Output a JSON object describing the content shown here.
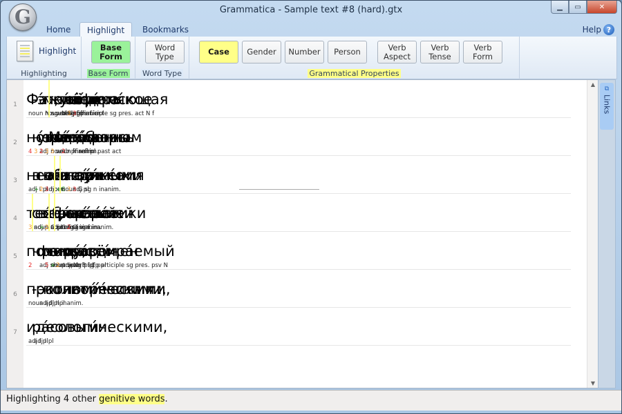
{
  "window": {
    "title": "Grammatica - Sample text #8 (hard).gtx",
    "orb_letter": "G",
    "controls": {
      "minimize": "▁",
      "maximize": "▭",
      "close": "✕"
    }
  },
  "tabs": [
    {
      "label": "Home",
      "active": false
    },
    {
      "label": "Highlight",
      "active": true
    },
    {
      "label": "Bookmarks",
      "active": false
    }
  ],
  "help": {
    "label": "Help",
    "icon": "?"
  },
  "ribbon": {
    "groups": [
      {
        "label": "Highlighting",
        "buttons": [
          "Highlight"
        ]
      },
      {
        "label": "Base Form",
        "label_color": "#9af29a",
        "buttons": [
          "Base Form"
        ]
      },
      {
        "label": "Word Type",
        "label_color": "#dce9f8",
        "buttons": [
          "Word Type"
        ]
      },
      {
        "label": "Grammatical Properties",
        "label_color": "#ffff88",
        "buttons": [
          "Case",
          "Gender",
          "Number",
          "Person",
          "Verb Aspect",
          "Verb Tense",
          "Verb Form"
        ]
      }
    ],
    "highlight_label": "Highlight",
    "base_form": [
      "Base",
      "Form"
    ],
    "word_type": [
      "Word",
      "Type"
    ],
    "case": "Case",
    "gender": "Gender",
    "number": "Number",
    "person": "Person",
    "verb_aspect": [
      "Verb",
      "Aspect"
    ],
    "verb_tense": [
      "Verb",
      "Tense"
    ],
    "verb_form": [
      "Verb",
      "Form"
    ],
    "active_colors": {
      "base_form": "#9af29a",
      "case": "#ffff88"
    }
  },
  "lines": [
    {
      "number": "1",
      "words": [
        {
          "text": "Фантасти́ческое",
          "ann": [
            {
              "t": "noun N sg n inanim."
            }
          ]
        },
        {
          "text": "-"
        },
        {
          "text": "э́то"
        },
        {
          "text": "мета́фора",
          "ann": [
            {
              "t": "noun N sg f inanim."
            }
          ]
        },
        {
          "text": "жи́зни",
          "hl": true,
          "ann": [
            {
              "t": "noun G sg f"
            }
          ]
        },
        {
          "text": ", позволя́ющая",
          "ann": [
            {
              "t": "verb ipf participle sg pres. act N f"
            }
          ]
        },
        {
          "text": "уви́деть",
          "ann": [
            {
              "t": "verb pf inf. act"
            }
          ]
        },
        {
          "text": "её",
          "ann": [
            {
              "n": "3",
              "c": "or"
            },
            {
              "t": "prn"
            }
          ]
        },
        {
          "text": "под",
          "ann": [
            {
              "n": "3",
              "c": "rd"
            }
          ]
        }
      ]
    },
    {
      "number": "2",
      "words": [
        {
          "text": "но́вым,",
          "ann": [
            {
              "n": "4",
              "c": "rd"
            }
          ]
        },
        {
          "text": "неожи́данным",
          "ann": [
            {
              "n": "3",
              "c": "or"
            },
            {
              "t": "adj"
            }
          ]
        },
        {
          "text": "угло́м",
          "ann": [
            {
              "n": "2",
              "c": "rd"
            }
          ]
        },
        {
          "text": "зре́ния.",
          "ann": [
            {
              "n": "3",
              "c": "or"
            },
            {
              "t": "noun n inanim."
            }
          ]
        },
        {
          "text": "Мета́форы",
          "ann": [
            {
              "n": "3",
              "c": "or"
            },
            {
              "t": "noun f inanim."
            }
          ]
        },
        {
          "text": "сде́лались",
          "ann": [
            {
              "t": "verb pf refl pl past act"
            }
          ]
        },
        {
          "text": "осо́бенно",
          "ann": [
            {
              "n": "2",
              "c": "rd"
            }
          ]
        }
      ]
    },
    {
      "number": "3",
      "words": [
        {
          "text": "необходи́мыми",
          "ann": [
            {
              "t": "adj I pl"
            }
          ]
        },
        {
          "text": "в",
          "ann": [
            {
              "n": "+",
              "c": "gr"
            }
          ]
        },
        {
          "text": "наш",
          "ann": [
            {
              "n": "2",
              "c": "or"
            },
            {
              "t": "adjprn"
            }
          ]
        },
        {
          "text": "век",
          "ann": [
            {
              "n": "3",
              "c": "rd"
            },
            {
              "t": "noun"
            }
          ]
        },
        {
          "text": "не то́лько"
        },
        {
          "text": "и́з-за",
          "hl": true,
          "inner_white": true,
          "ann": [
            {
              "n": "+G",
              "c": "gr"
            }
          ]
        },
        {
          "text": "вторже́ния",
          "hl": true,
          "ann": [
            {
              "t": "noun G sg n inanim."
            }
          ]
        },
        {
          "text": "нау́чных",
          "ann": [
            {
              "n": "3",
              "c": "or"
            },
            {
              "t": "adj pl"
            }
          ]
        },
        {
          "text": "и",
          "ann": [
            {
              "n": "3",
              "c": "rd"
            }
          ]
        }
      ]
    },
    {
      "number": "4",
      "words": [
        {
          "text": "техни́ческих",
          "ann": [
            {
              "n": "3",
              "c": "or"
            },
            {
              "t": "adj pl"
            }
          ]
        },
        {
          "text": "сверше́ний",
          "hl": true,
          "ann": [
            {
              "t": "noun G pl n inanim."
            }
          ]
        },
        {
          "text": "в",
          "ann": [
            {
              "n": "+",
              "c": "gr"
            }
          ]
        },
        {
          "text": "о́бласть",
          "ann": [
            {
              "n": "2",
              "c": "or"
            },
            {
              "t": "noun sg f inanim."
            }
          ]
        },
        {
          "text": "вчера́шней",
          "hl": true,
          "ann": [
            {
              "t": "adj G f sg"
            }
          ]
        },
        {
          "text": "фанта́стики",
          "hl": true,
          "ann": [
            {
              "t": "noun G sg f inanim."
            }
          ]
        },
        {
          "text": ", но"
        },
        {
          "text": "скоре́е",
          "ann": [
            {
              "n": "2",
              "c": "rd"
            }
          ]
        }
      ]
    },
    {
      "number": "5",
      "words": [
        {
          "text": "потому́,",
          "ann": [
            {
              "n": "2",
              "c": "rd"
            }
          ]
        },
        {
          "text": "что"
        },
        {
          "text": "фантасти́чен",
          "ann": [
            {
              "t": "adj short m sg"
            }
          ]
        },
        {
          "text": "мир,",
          "ann": [
            {
              "n": "5",
              "c": "rd"
            },
            {
              "t": "noun"
            }
          ]
        },
        {
          "text": "в",
          "ann": [
            {
              "n": "+",
              "c": "gr"
            }
          ]
        },
        {
          "text": "кото́ром",
          "ann": [
            {
              "n": "2",
              "c": "or"
            },
            {
              "t": "adjprn P sg"
            }
          ]
        },
        {
          "text": "мы",
          "ann": [
            {
              "t": "prn N"
            }
          ]
        },
        {
          "text": "живём,",
          "ann": [
            {
              "t": "verb ipf 1p pl"
            }
          ]
        },
        {
          "text": "раздира́емый",
          "ann": [
            {
              "t": "verb ipf participle sg pres. psv N"
            }
          ]
        }
      ]
    },
    {
      "number": "6",
      "words": [
        {
          "text": "противоре́чиями",
          "ann": [
            {
              "t": "noun I pl n inanim."
            }
          ]
        },
        {
          "text": "-"
        },
        {
          "text": "экономи́ческими,",
          "ann": [
            {
              "t": "adj I pl"
            }
          ]
        },
        {
          "text": "полити́ческими,",
          "ann": [
            {
              "t": "adj I pl"
            }
          ]
        }
      ]
    },
    {
      "number": "7",
      "words": [
        {
          "text": "идеологи́ческими,",
          "ann": [
            {
              "t": "adj I pl"
            }
          ]
        },
        {
          "text": "ра́совыми.",
          "ann": [
            {
              "t": "adj I pl"
            }
          ]
        }
      ]
    }
  ],
  "links_pane": {
    "label": "Links",
    "icon": "link-icon"
  },
  "status": {
    "prefix": "Highlighting 4 other ",
    "highlight": "genitive words",
    "suffix": ".",
    "highlight_color": "#ffff88"
  }
}
